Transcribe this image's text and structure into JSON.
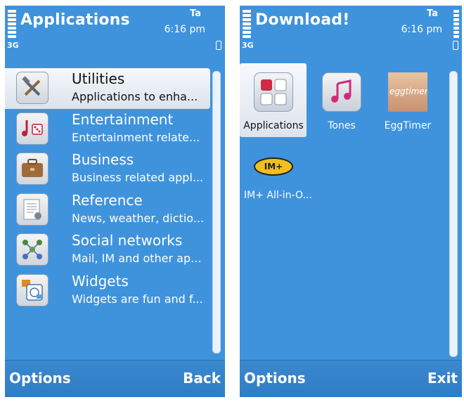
{
  "left_screen": {
    "title": "Applications",
    "time": "6:16 pm",
    "network_indicator": "Ta",
    "network_type": "3G",
    "list_items": [
      {
        "title": "Utilities",
        "subtitle": "Applications to enha...",
        "icon": "utilities-icon",
        "selected": true
      },
      {
        "title": "Entertainment",
        "subtitle": "Entertainment relate...",
        "icon": "entertainment-icon",
        "selected": false
      },
      {
        "title": "Business",
        "subtitle": "Business related appl...",
        "icon": "briefcase-icon",
        "selected": false
      },
      {
        "title": "Reference",
        "subtitle": "News, weather, dictio...",
        "icon": "document-icon",
        "selected": false
      },
      {
        "title": "Social networks",
        "subtitle": "Mail, IM and other ap...",
        "icon": "social-network-icon",
        "selected": false
      },
      {
        "title": "Widgets",
        "subtitle": "Widgets are fun and f...",
        "icon": "widgets-icon",
        "selected": false
      }
    ],
    "softkeys": {
      "left": "Options",
      "right": "Back"
    }
  },
  "right_screen": {
    "title": "Download!",
    "time": "6:16 pm",
    "network_indicator": "Ta",
    "network_type": "3G",
    "grid_items": [
      {
        "label": "Applications",
        "icon": "applications-icon",
        "selected": true
      },
      {
        "label": "Tones",
        "icon": "music-note-icon",
        "selected": false
      },
      {
        "label": "EggTimer",
        "icon": "eggtimer-icon",
        "icon_text": "eggtimer",
        "selected": false
      },
      {
        "label": "IM+ All-in-O...",
        "icon": "im-plus-icon",
        "icon_text": "IM+",
        "selected": false
      }
    ],
    "softkeys": {
      "left": "Options",
      "right": "Exit"
    }
  },
  "colors": {
    "screen_bg": "#3f93dc",
    "selection_bg": "#e8edf3",
    "text": "#ffffff"
  }
}
